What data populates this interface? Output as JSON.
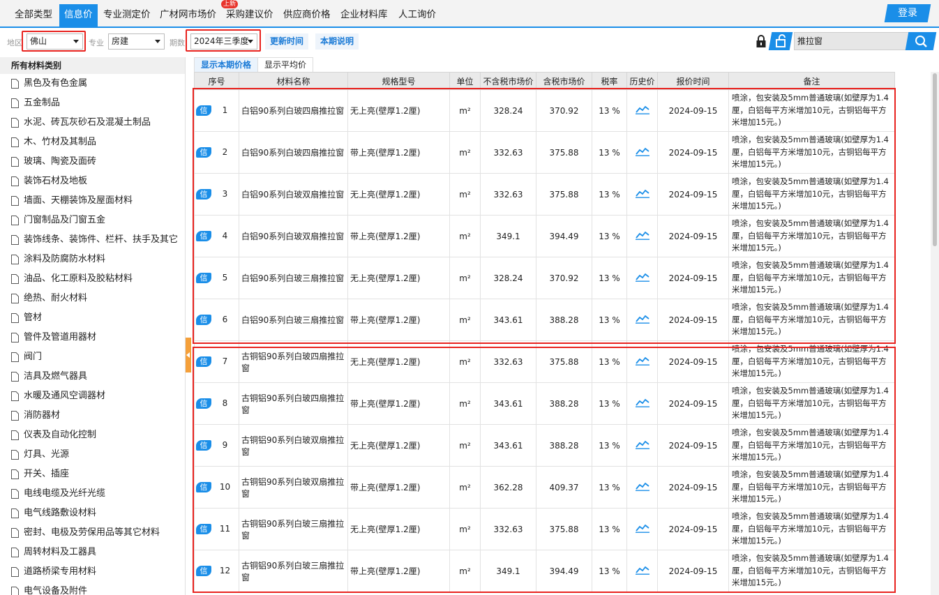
{
  "nav": {
    "tabs": [
      {
        "label": "全部类型"
      },
      {
        "label": "信息价"
      },
      {
        "label": "专业测定价"
      },
      {
        "label": "广材网市场价"
      },
      {
        "label": "采购建议价"
      },
      {
        "label": "供应商价格"
      },
      {
        "label": "企业材料库"
      },
      {
        "label": "人工询价"
      }
    ],
    "badge": "上新",
    "login": "登录"
  },
  "filter": {
    "region_label": "地区",
    "region_value": "佛山",
    "major_label": "专业",
    "major_value": "房建",
    "period_label": "期数",
    "period_value": "2024年三季度",
    "update_time": "更新时间",
    "period_note": "本期说明",
    "search_value": "推拉窗"
  },
  "sidebar": {
    "title": "所有材料类别",
    "items": [
      "黑色及有色金属",
      "五金制品",
      "水泥、砖瓦灰砂石及混凝土制品",
      "木、竹材及其制品",
      "玻璃、陶瓷及面砖",
      "装饰石材及地板",
      "墙面、天棚装饰及屋面材料",
      "门窗制品及门窗五金",
      "装饰线条、装饰件、栏杆、扶手及其它",
      "涂料及防腐防水材料",
      "油品、化工原料及胶粘材料",
      "绝热、耐火材料",
      "管材",
      "管件及管道用器材",
      "阀门",
      "洁具及燃气器具",
      "水暖及通风空调器材",
      "消防器材",
      "仪表及自动化控制",
      "灯具、光源",
      "开关、插座",
      "电线电缆及光纤光缆",
      "电气线路敷设材料",
      "密封、电极及劳保用品等其它材料",
      "周转材料及工器具",
      "道路桥梁专用材料",
      "电气设备及附件"
    ]
  },
  "table_tabs": {
    "current": "显示本期价格",
    "average": "显示平均价"
  },
  "table": {
    "headers": [
      "序号",
      "材料名称",
      "规格型号",
      "单位",
      "不含税市场价",
      "含税市场价",
      "税率",
      "历史价",
      "报价时间",
      "备注"
    ],
    "xin_label": "信",
    "rows": [
      {
        "no": "1",
        "name": "白铝90系列白玻四扇推拉窗",
        "spec": "无上亮(壁厚1.2厘)",
        "unit": "m²",
        "price_ex": "328.24",
        "price_in": "370.92",
        "tax": "13 %",
        "date": "2024-09-15",
        "note": "喷涂，包安装及5mm普通玻璃(如壁厚为1.4厘，白铝每平方米增加10元，古铜铝每平方米增加15元。)"
      },
      {
        "no": "2",
        "name": "白铝90系列白玻四扇推拉窗",
        "spec": "带上亮(壁厚1.2厘)",
        "unit": "m²",
        "price_ex": "332.63",
        "price_in": "375.88",
        "tax": "13 %",
        "date": "2024-09-15",
        "note": "喷涂，包安装及5mm普通玻璃(如壁厚为1.4厘，白铝每平方米增加10元，古铜铝每平方米增加15元。)"
      },
      {
        "no": "3",
        "name": "白铝90系列白玻双扇推拉窗",
        "spec": "无上亮(壁厚1.2厘)",
        "unit": "m²",
        "price_ex": "332.63",
        "price_in": "375.88",
        "tax": "13 %",
        "date": "2024-09-15",
        "note": "喷涂，包安装及5mm普通玻璃(如壁厚为1.4厘，白铝每平方米增加10元，古铜铝每平方米增加15元。)"
      },
      {
        "no": "4",
        "name": "白铝90系列白玻双扇推拉窗",
        "spec": "带上亮(壁厚1.2厘)",
        "unit": "m²",
        "price_ex": "349.1",
        "price_in": "394.49",
        "tax": "13 %",
        "date": "2024-09-15",
        "note": "喷涂，包安装及5mm普通玻璃(如壁厚为1.4厘，白铝每平方米增加10元，古铜铝每平方米增加15元。)"
      },
      {
        "no": "5",
        "name": "白铝90系列白玻三扇推拉窗",
        "spec": "无上亮(壁厚1.2厘)",
        "unit": "m²",
        "price_ex": "328.24",
        "price_in": "370.92",
        "tax": "13 %",
        "date": "2024-09-15",
        "note": "喷涂，包安装及5mm普通玻璃(如壁厚为1.4厘，白铝每平方米增加10元，古铜铝每平方米增加15元。)"
      },
      {
        "no": "6",
        "name": "白铝90系列白玻三扇推拉窗",
        "spec": "带上亮(壁厚1.2厘)",
        "unit": "m²",
        "price_ex": "343.61",
        "price_in": "388.28",
        "tax": "13 %",
        "date": "2024-09-15",
        "note": "喷涂，包安装及5mm普通玻璃(如壁厚为1.4厘，白铝每平方米增加10元，古铜铝每平方米增加15元。)"
      },
      {
        "no": "7",
        "name": "古铜铝90系列白玻四扇推拉窗",
        "spec": "无上亮(壁厚1.2厘)",
        "unit": "m²",
        "price_ex": "332.63",
        "price_in": "375.88",
        "tax": "13 %",
        "date": "2024-09-15",
        "note": "喷涂，包安装及5mm普通玻璃(如壁厚为1.4厘，白铝每平方米增加10元，古铜铝每平方米增加15元。)"
      },
      {
        "no": "8",
        "name": "古铜铝90系列白玻四扇推拉窗",
        "spec": "带上亮(壁厚1.2厘)",
        "unit": "m²",
        "price_ex": "343.61",
        "price_in": "388.28",
        "tax": "13 %",
        "date": "2024-09-15",
        "note": "喷涂，包安装及5mm普通玻璃(如壁厚为1.4厘，白铝每平方米增加10元，古铜铝每平方米增加15元。)"
      },
      {
        "no": "9",
        "name": "古铜铝90系列白玻双扇推拉窗",
        "spec": "无上亮(壁厚1.2厘)",
        "unit": "m²",
        "price_ex": "343.61",
        "price_in": "388.28",
        "tax": "13 %",
        "date": "2024-09-15",
        "note": "喷涂，包安装及5mm普通玻璃(如壁厚为1.4厘，白铝每平方米增加10元，古铜铝每平方米增加15元。)"
      },
      {
        "no": "10",
        "name": "古铜铝90系列白玻双扇推拉窗",
        "spec": "带上亮(壁厚1.2厘)",
        "unit": "m²",
        "price_ex": "362.28",
        "price_in": "409.37",
        "tax": "13 %",
        "date": "2024-09-15",
        "note": "喷涂，包安装及5mm普通玻璃(如壁厚为1.4厘，白铝每平方米增加10元，古铜铝每平方米增加15元。)"
      },
      {
        "no": "11",
        "name": "古铜铝90系列白玻三扇推拉窗",
        "spec": "无上亮(壁厚1.2厘)",
        "unit": "m²",
        "price_ex": "332.63",
        "price_in": "375.88",
        "tax": "13 %",
        "date": "2024-09-15",
        "note": "喷涂，包安装及5mm普通玻璃(如壁厚为1.4厘，白铝每平方米增加10元，古铜铝每平方米增加15元。)"
      },
      {
        "no": "12",
        "name": "古铜铝90系列白玻三扇推拉窗",
        "spec": "带上亮(壁厚1.2厘)",
        "unit": "m²",
        "price_ex": "349.1",
        "price_in": "394.49",
        "tax": "13 %",
        "date": "2024-09-15",
        "note": "喷涂，包安装及5mm普通玻璃(如壁厚为1.4厘，白铝每平方米增加10元，古铜铝每平方米增加15元。)"
      }
    ]
  },
  "colors": {
    "accent": "#1a8ee8",
    "highlight": "#e8221e",
    "collapse_tab": "#f5a03a"
  },
  "icons": {
    "lock": "lock-icon",
    "unlock": "unlock-icon",
    "search": "search-icon",
    "history": "trend-chart-icon",
    "doc": "document-icon"
  }
}
